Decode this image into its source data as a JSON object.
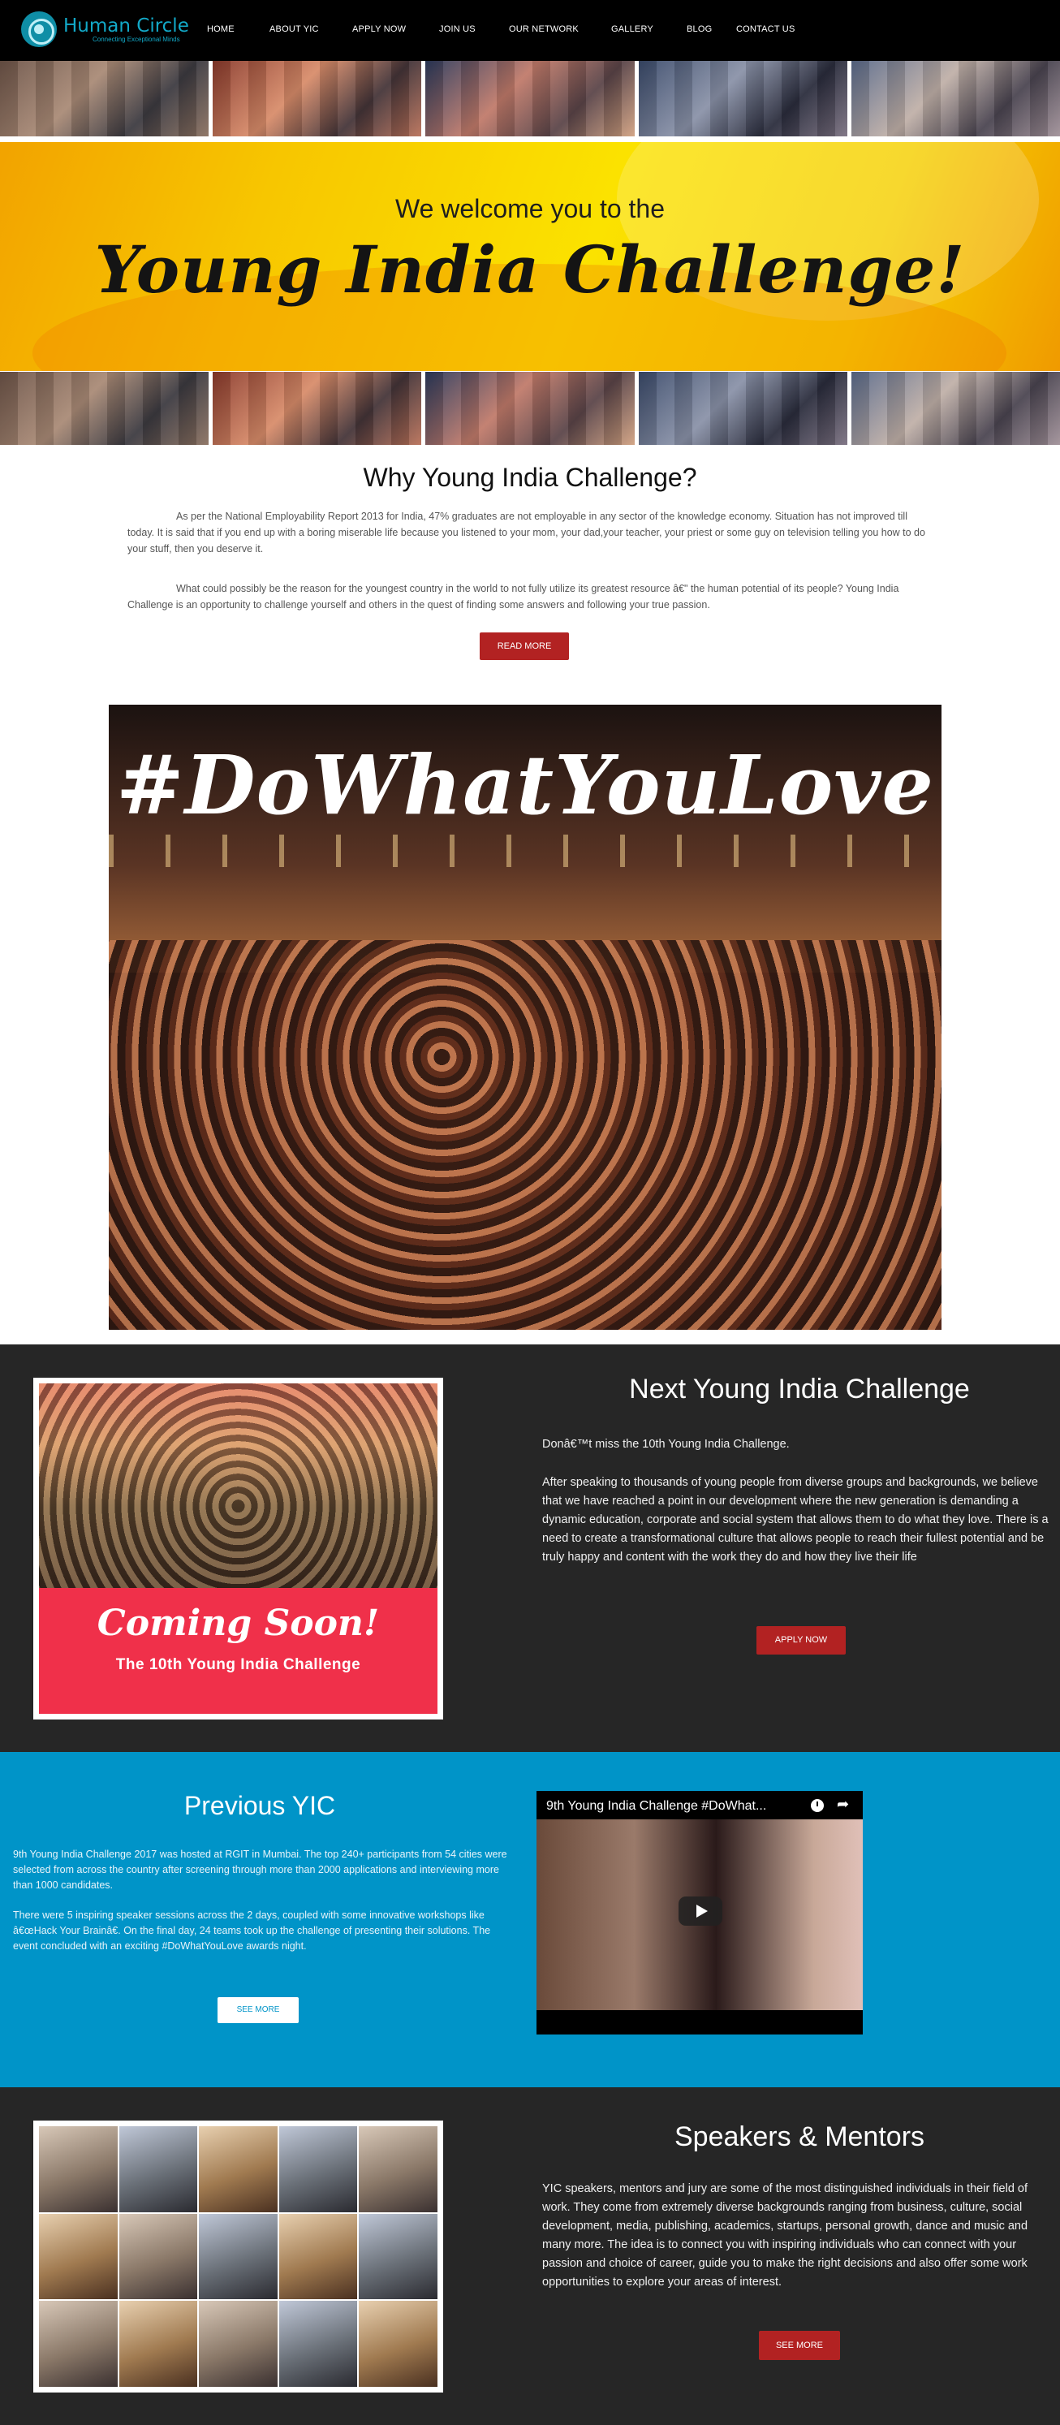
{
  "header": {
    "logo": {
      "name": "Human Circle",
      "tagline": "Connecting Exceptional Minds"
    },
    "nav": [
      "HOME",
      "ABOUT YIC",
      "APPLY NOW",
      "JOIN US",
      "OUR NETWORK",
      "GALLERY",
      "BLOG",
      "CONTACT US"
    ]
  },
  "banner": {
    "welcome": "We welcome you to the",
    "title": "Young India Challenge!"
  },
  "why": {
    "title": "Why Young India Challenge?",
    "para1": "As per the National Employability Report 2013 for India, 47% graduates are not employable in any sector of the knowledge economy. Situation has not improved till today. It is said that if you end up with a boring miserable life because you listened to your mom, your dad,your teacher, your priest or some guy on television telling you how to do your stuff, then you deserve it.",
    "para2": "What could possibly be the reason for the youngest country in the world to not fully utilize its greatest resource â€\" the human potential of its people? Young India Challenge is an opportunity to challenge yourself and others in the quest of finding some answers and following your true passion.",
    "button": "READ MORE"
  },
  "dwyl": {
    "hashtag": "#DoWhatYouLove"
  },
  "next": {
    "poster_title": "Coming Soon!",
    "poster_sub": "The 10th Young India Challenge",
    "title": "Next Young India Challenge",
    "intro": "Donâ€™t miss the 10th Young India Challenge.",
    "body": "After speaking to thousands of young people from diverse groups and backgrounds, we believe that we have reached a point in our development where the new generation is demanding a dynamic education, corporate and social system that allows them to do what they love. There is a need to create a transformational culture that allows people to reach their fullest potential and be truly happy and content with the work they do and how they live their life",
    "button": "APPLY NOW"
  },
  "previous": {
    "title": "Previous YIC",
    "para1": "9th Young India Challenge 2017 was hosted at RGIT in Mumbai. The top 240+ participants from 54 cities were selected from across the country after screening through more than 2000 applications and interviewing more than 1000 candidates.",
    "para2": "There were 5 inspiring speaker sessions across the 2 days, coupled with some innovative workshops like â€œHack Your Brainâ€. On the final day, 24 teams took up the challenge of presenting their solutions. The event concluded with an exciting #DoWhatYouLove awards night.",
    "button": "SEE MORE",
    "video_title": "9th Young India Challenge #DoWhat..."
  },
  "speakers": {
    "title": "Speakers & Mentors",
    "body": "YIC speakers, mentors and jury are some of the most distinguished individuals in their field of work. They come from extremely diverse backgrounds ranging from business, culture, social development, media, publishing, academics, startups, personal growth, dance and music and many more. The idea is to connect you with inspiring individuals who can connect with your passion and choice of career, guide you to make the right decisions and also offer some work opportunities to explore your areas of interest.",
    "button": "SEE MORE"
  },
  "colors": {
    "accent_red": "#b22222",
    "section_dark": "#262626",
    "section_blue": "#0094c8",
    "logo_teal": "#12a9c8"
  }
}
